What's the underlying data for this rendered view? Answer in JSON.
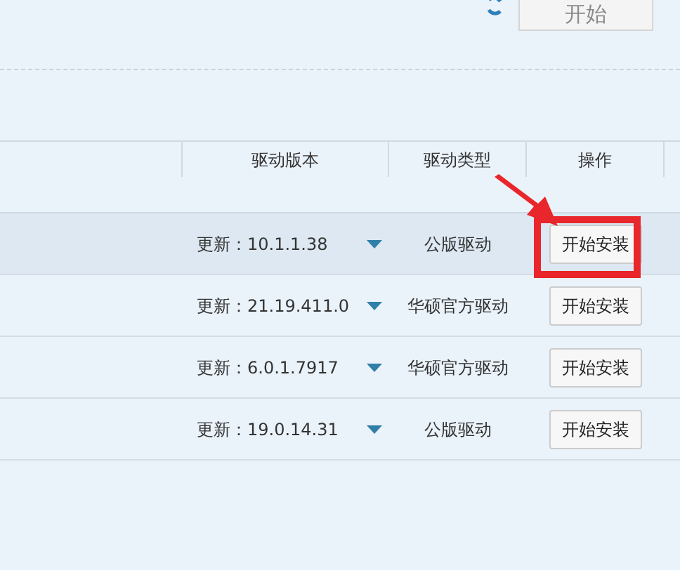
{
  "toolbar": {
    "start_button": "开始"
  },
  "table": {
    "columns": [
      "驱动版本",
      "驱动类型",
      "操作"
    ],
    "rows": [
      {
        "selected": true,
        "highlighted": true,
        "version": "更新：10.1.1.38",
        "type": "公版驱动",
        "action": "开始安装"
      },
      {
        "selected": false,
        "highlighted": false,
        "version": "更新：21.19.411.0",
        "type": "华硕官方驱动",
        "action": "开始安装"
      },
      {
        "selected": false,
        "highlighted": false,
        "version": "更新：6.0.1.7917",
        "type": "华硕官方驱动",
        "action": "开始安装"
      },
      {
        "selected": false,
        "highlighted": false,
        "version": "更新：19.0.14.31",
        "type": "公版驱动",
        "action": "开始安装"
      }
    ]
  }
}
